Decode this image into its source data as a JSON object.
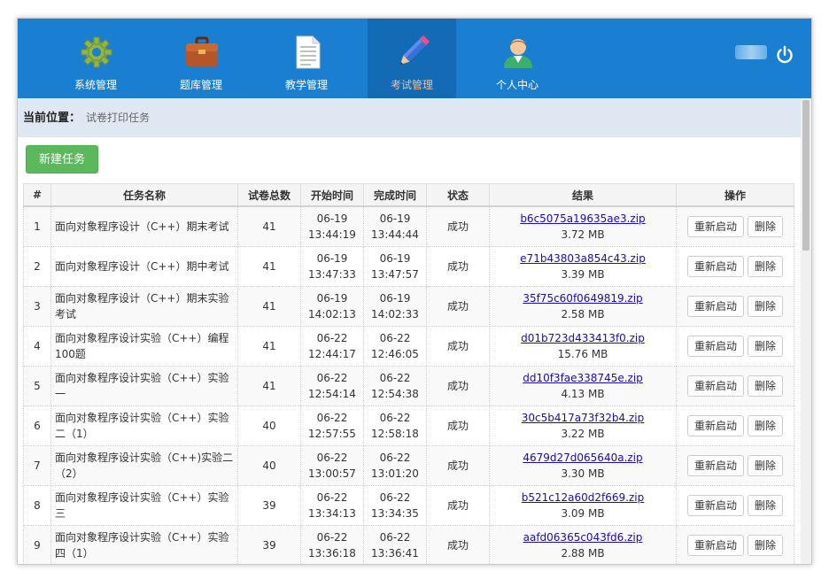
{
  "nav": {
    "items": [
      {
        "label": "系统管理",
        "icon": "gear-icon"
      },
      {
        "label": "题库管理",
        "icon": "briefcase-icon"
      },
      {
        "label": "教学管理",
        "icon": "document-icon"
      },
      {
        "label": "考试管理",
        "icon": "pencil-icon",
        "active": true
      },
      {
        "label": "个人中心",
        "icon": "user-icon"
      }
    ],
    "power_icon": "power-icon"
  },
  "breadcrumb": {
    "label": "当前位置：",
    "value": "试卷打印任务"
  },
  "toolbar": {
    "new_task": "新建任务"
  },
  "table": {
    "headers": [
      "#",
      "任务名称",
      "试卷总数",
      "开始时间",
      "完成时间",
      "状态",
      "结果",
      "操作"
    ],
    "rows": [
      {
        "no": "1",
        "name": "面向对象程序设计（C++）期末考试",
        "total": "41",
        "start_date": "06-19",
        "start_time": "13:44:19",
        "end_date": "06-19",
        "end_time": "13:44:44",
        "status": "成功",
        "file": "b6c5075a19635ae3.zip",
        "size": "3.72 MB"
      },
      {
        "no": "2",
        "name": "面向对象程序设计（C++）期中考试",
        "total": "41",
        "start_date": "06-19",
        "start_time": "13:47:33",
        "end_date": "06-19",
        "end_time": "13:47:57",
        "status": "成功",
        "file": "e71b43803a854c43.zip",
        "size": "3.39 MB"
      },
      {
        "no": "3",
        "name": "面向对象程序设计（C++）期末实验考试",
        "total": "41",
        "start_date": "06-19",
        "start_time": "14:02:13",
        "end_date": "06-19",
        "end_time": "14:02:33",
        "status": "成功",
        "file": "35f75c60f0649819.zip",
        "size": "2.58 MB"
      },
      {
        "no": "4",
        "name": "面向对象程序设计实验（C++）编程100题",
        "total": "41",
        "start_date": "06-22",
        "start_time": "12:44:17",
        "end_date": "06-22",
        "end_time": "12:46:05",
        "status": "成功",
        "file": "d01b723d433413f0.zip",
        "size": "15.76 MB"
      },
      {
        "no": "5",
        "name": "面向对象程序设计实验（C++）实验一",
        "total": "41",
        "start_date": "06-22",
        "start_time": "12:54:14",
        "end_date": "06-22",
        "end_time": "12:54:38",
        "status": "成功",
        "file": "dd10f3fae338745e.zip",
        "size": "4.13 MB"
      },
      {
        "no": "6",
        "name": "面向对象程序设计实验（C++）实验二（1）",
        "total": "40",
        "start_date": "06-22",
        "start_time": "12:57:55",
        "end_date": "06-22",
        "end_time": "12:58:18",
        "status": "成功",
        "file": "30c5b417a73f32b4.zip",
        "size": "3.22 MB"
      },
      {
        "no": "7",
        "name": "面向对象程序设计实验（C++)实验二（2）",
        "total": "40",
        "start_date": "06-22",
        "start_time": "13:00:57",
        "end_date": "06-22",
        "end_time": "13:01:20",
        "status": "成功",
        "file": "4679d27d065640a.zip",
        "size": "3.30 MB"
      },
      {
        "no": "8",
        "name": "面向对象程序设计实验（C++）实验三",
        "total": "39",
        "start_date": "06-22",
        "start_time": "13:34:13",
        "end_date": "06-22",
        "end_time": "13:34:35",
        "status": "成功",
        "file": "b521c12a60d2f669.zip",
        "size": "3.09 MB"
      },
      {
        "no": "9",
        "name": "面向对象程序设计实验（C++）实验四（1）",
        "total": "39",
        "start_date": "06-22",
        "start_time": "13:36:18",
        "end_date": "06-22",
        "end_time": "13:36:41",
        "status": "成功",
        "file": "aafd06365c043fd6.zip",
        "size": "2.88 MB"
      }
    ],
    "actions": {
      "restart": "重新启动",
      "delete": "删除"
    }
  },
  "colors": {
    "nav_bg": "#1a7fd0",
    "nav_active": "#136ab5",
    "new_button": "#5cb85c",
    "breadcrumb_bg": "#dfe8f2"
  }
}
